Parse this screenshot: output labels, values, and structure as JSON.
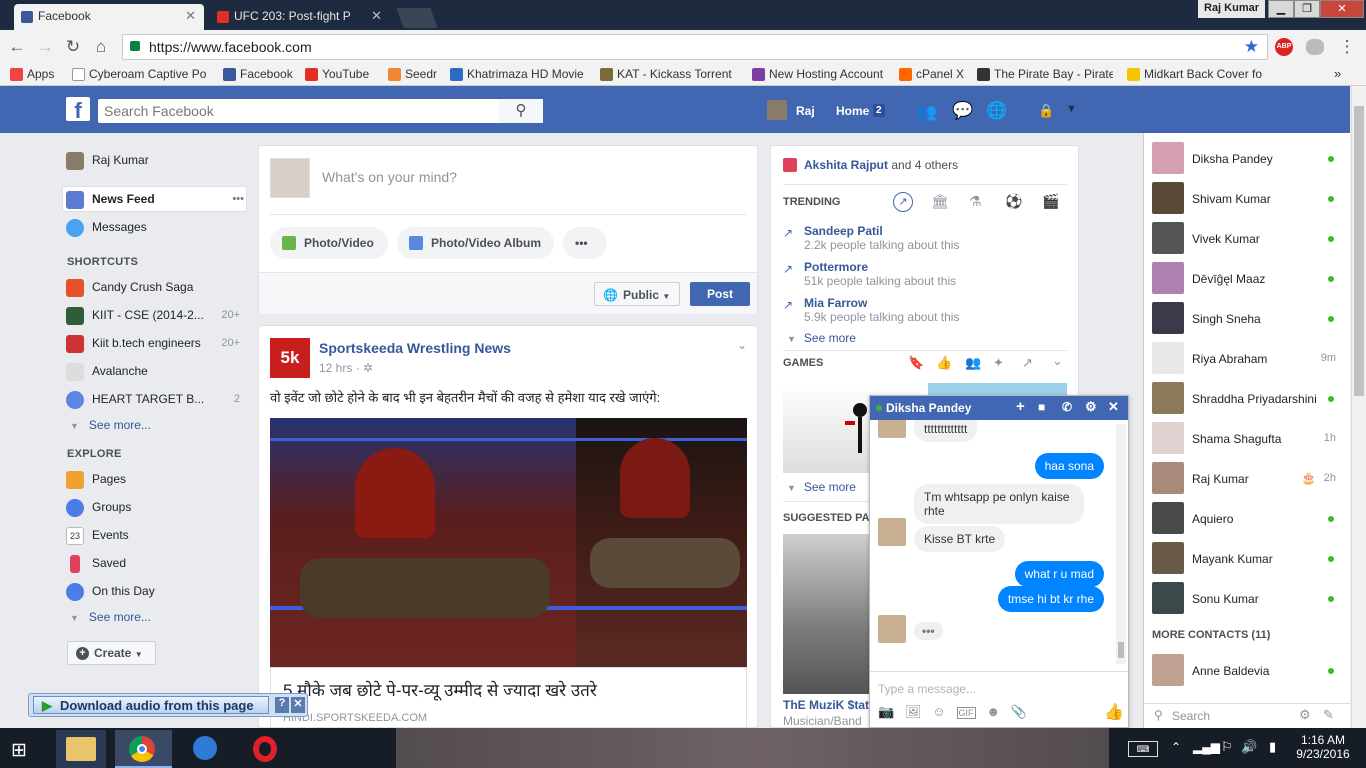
{
  "browser": {
    "tabs": [
      {
        "title": "Facebook",
        "active": true,
        "favicon": "facebook-favicon"
      },
      {
        "title": "UFC 203: Post-fight P",
        "active": false,
        "favicon": "youtube-favicon"
      }
    ],
    "profile_name": "Raj Kumar",
    "url": "https://www.facebook.com",
    "bookmarks": [
      {
        "label": "Apps",
        "favicon": "apps-grid-icon"
      },
      {
        "label": "Cyberoam Captive Po",
        "favicon": "page-icon"
      },
      {
        "label": "Facebook",
        "favicon": "facebook-favicon"
      },
      {
        "label": "YouTube",
        "favicon": "youtube-favicon"
      },
      {
        "label": "Seedr",
        "favicon": "seedr-favicon"
      },
      {
        "label": "Khatrimaza HD Movie",
        "favicon": "w-favicon"
      },
      {
        "label": "KAT - Kickass Torrent",
        "favicon": "kat-favicon"
      },
      {
        "label": "New Hosting Account",
        "favicon": "hosting-favicon"
      },
      {
        "label": "cPanel X",
        "favicon": "cpanel-favicon"
      },
      {
        "label": "The Pirate Bay - Pirate",
        "favicon": "pirate-favicon"
      },
      {
        "label": "Midkart Back Cover fo",
        "favicon": "midkart-favicon"
      }
    ],
    "more_bookmarks": "»"
  },
  "fb_header": {
    "logo": "f",
    "search_placeholder": "Search Facebook",
    "user": "Raj",
    "home": "Home",
    "home_count": "2"
  },
  "left_nav": {
    "profile": "Raj Kumar",
    "items": [
      {
        "label": "News Feed",
        "more": "•••"
      },
      {
        "label": "Messages"
      }
    ],
    "shortcuts_heading": "SHORTCUTS",
    "shortcuts": [
      {
        "label": "Candy Crush Saga",
        "count": ""
      },
      {
        "label": "KIIT - CSE (2014-2...",
        "count": "20+"
      },
      {
        "label": "Kiit b.tech engineers",
        "count": "20+"
      },
      {
        "label": "Avalanche",
        "count": ""
      },
      {
        "label": "HEART TARGET B...",
        "count": "2"
      }
    ],
    "see_more_1": "See more...",
    "explore_heading": "EXPLORE",
    "explore": [
      {
        "label": "Pages"
      },
      {
        "label": "Groups"
      },
      {
        "label": "Events",
        "icon_text": "23"
      },
      {
        "label": "Saved"
      },
      {
        "label": "On this Day"
      }
    ],
    "see_more_2": "See more...",
    "create": "Create"
  },
  "composer": {
    "placeholder": "What's on your mind?",
    "photo_video": "Photo/Video",
    "album": "Photo/Video Album",
    "more": "•••",
    "audience": "Public",
    "post": "Post"
  },
  "post": {
    "page": "Sportskeeda Wrestling News",
    "logo_text": "5k",
    "time": "12 hrs",
    "text": "वो इवेंट जो छोटे होने के बाद भी इन बेहतरीन मैचों की वजह से हमेशा याद रखे जाएंगे:",
    "link_title": "5 मौके जब छोटे पे-पर-व्यू उम्मीद से ज्यादा खरे उतरे",
    "link_domain": "HINDI.SPORTSKEEDA.COM"
  },
  "right_col": {
    "birthday_name": "Akshita Rajput",
    "birthday_rest": "and 4 others",
    "trending_heading": "TRENDING",
    "trending": [
      {
        "title": "Sandeep Patil",
        "sub": "2.2k people talking about this"
      },
      {
        "title": "Pottermore",
        "sub": "51k people talking about this"
      },
      {
        "title": "Mia Farrow",
        "sub": "5.9k people talking about this"
      }
    ],
    "see_more": "See more",
    "games_heading": "GAMES",
    "games_see_more": "See more",
    "suggested_heading": "SUGGESTED PA",
    "suggested_name": "ThE MuziK $tati",
    "suggested_cat": "Musician/Band"
  },
  "chat": {
    "partner": "Diksha Pandey",
    "messages": [
      {
        "dir": "in",
        "text": "ttttttttttttt"
      },
      {
        "dir": "out",
        "text": "haa sona"
      },
      {
        "dir": "in",
        "text": "Tm whtsapp pe onlyn kaise rhte"
      },
      {
        "dir": "in",
        "text": "Kisse BT krte"
      },
      {
        "dir": "out",
        "text": "what r u mad"
      },
      {
        "dir": "out",
        "text": "tmse hi bt kr rhe"
      }
    ],
    "typing": "•••",
    "input_placeholder": "Type a message..."
  },
  "contacts": [
    {
      "name": "Diksha Pandey",
      "status": "online"
    },
    {
      "name": "Shivam Kumar",
      "status": "online"
    },
    {
      "name": "Vivek Kumar",
      "status": "online"
    },
    {
      "name": "Dēvīĝęl Maaz",
      "status": "online"
    },
    {
      "name": "Singh Sneha",
      "status": "online"
    },
    {
      "name": "Riya Abraham",
      "status": "9m"
    },
    {
      "name": "Shraddha Priyadarshini",
      "status": "online"
    },
    {
      "name": "Shama Shagufta",
      "status": "1h"
    },
    {
      "name": "Raj Kumar",
      "status": "2h"
    },
    {
      "name": "Aquiero",
      "status": "online"
    },
    {
      "name": "Mayank Kumar",
      "status": "online"
    },
    {
      "name": "Sonu Kumar",
      "status": "online"
    }
  ],
  "more_contacts": "MORE CONTACTS (11)",
  "more_contacts_list": [
    {
      "name": "Anne Baldevia",
      "status": "online"
    }
  ],
  "chat_search": "Search",
  "download_audio": "Download audio from this page",
  "taskbar": {
    "time": "1:16 AM",
    "date": "9/23/2016"
  }
}
